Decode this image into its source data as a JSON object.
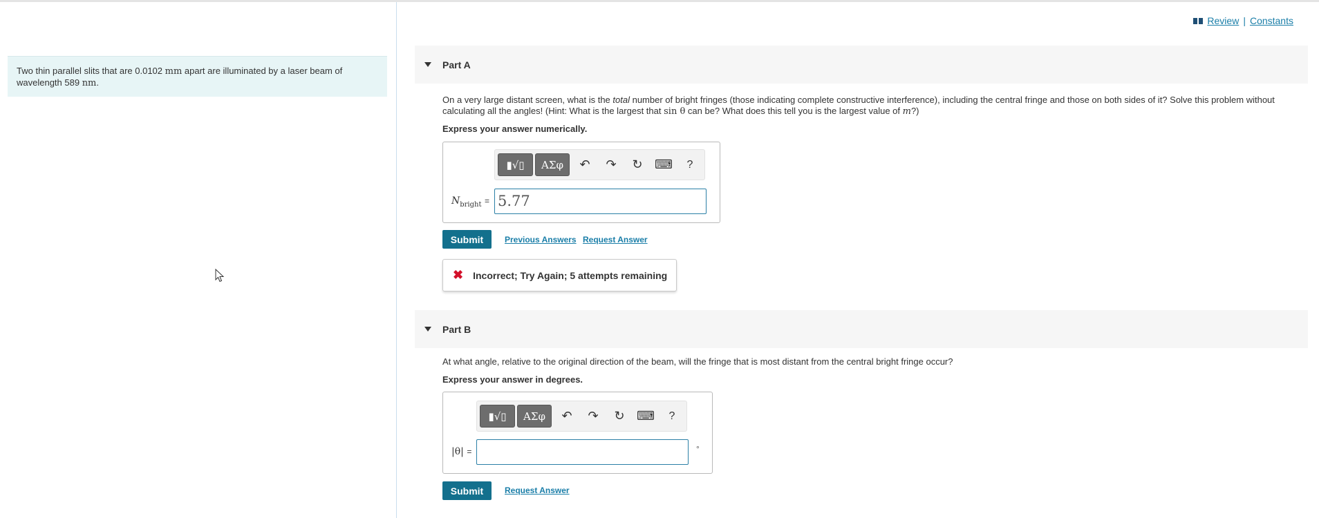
{
  "context": {
    "text_1": "Two thin parallel slits that are 0.0102 ",
    "unit_1": "mm",
    "text_2": " apart are illuminated by a laser beam of wavelength 589 ",
    "unit_2": "nm",
    "text_3": "."
  },
  "top_links": {
    "review": "Review",
    "separator": "|",
    "constants": "Constants"
  },
  "toolbar": {
    "templates": "▮√▯",
    "greek": "ΑΣφ",
    "undo": "↶",
    "redo": "↷",
    "reset": "↻",
    "keyboard": "⌨",
    "help": "?"
  },
  "part_a": {
    "title": "Part A",
    "question_1": "On a very large distant screen, what is the ",
    "question_em": "total",
    "question_2": " number of bright fringes (those indicating complete constructive interference), including the central fringe and those on both sides of it? Solve this problem without calculating all the angles! (Hint: What is the largest that ",
    "question_math": "sin θ",
    "question_3": " can be? What does this tell you is the largest value of ",
    "question_var": "m",
    "question_4": "?)",
    "instruction": "Express your answer numerically.",
    "var_main": "N",
    "var_sub": "bright",
    "equals": "=",
    "answer_value": "5.77",
    "submit": "Submit",
    "previous_answers": "Previous Answers",
    "request_answer": "Request Answer",
    "feedback": "Incorrect; Try Again; 5 attempts remaining"
  },
  "part_b": {
    "title": "Part B",
    "question": "At what angle, relative to the original direction of the beam, will the fringe that is most distant from the central bright fringe occur?",
    "instruction": "Express your answer in degrees.",
    "var_label": "|θ|",
    "equals": "=",
    "answer_value": "",
    "unit": "°",
    "submit": "Submit",
    "request_answer": "Request Answer"
  },
  "colors": {
    "accent": "#13708d",
    "link": "#1a7ea8",
    "error": "#d3102a",
    "context_bg": "#e7f5f6"
  }
}
